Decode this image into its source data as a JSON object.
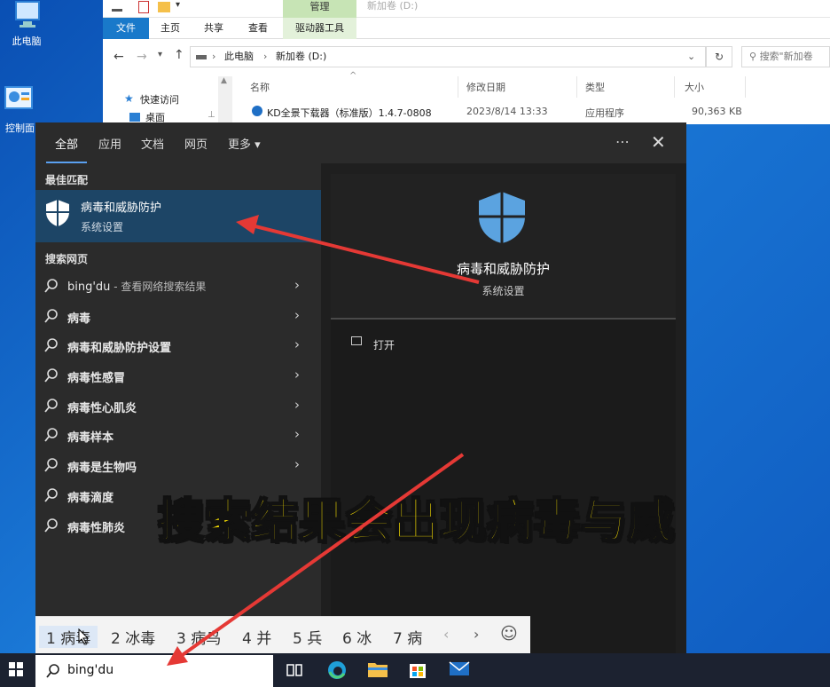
{
  "desktop": {
    "icons": [
      {
        "label": "此电脑",
        "icon": "computer-icon"
      },
      {
        "label": "控制面",
        "icon": "control-panel-icon"
      }
    ]
  },
  "explorer": {
    "manage_tab": "管理",
    "title": "新加卷 (D:)",
    "tabs": [
      "文件",
      "主页",
      "共享",
      "查看",
      "驱动器工具"
    ],
    "address_path": [
      "此电脑",
      "新加卷 (D:)"
    ],
    "search_placeholder": "搜索\"新加卷",
    "nav": {
      "quick_access": "快速访问",
      "desktop": "桌面"
    },
    "columns": [
      "名称",
      "修改日期",
      "类型",
      "大小"
    ],
    "rows": [
      {
        "name": "KD全景下载器（标准版）1.4.7-0808",
        "modified": "2023/8/14 13:33",
        "type": "应用程序",
        "size": "90,363 KB"
      }
    ]
  },
  "search_panel": {
    "tabs": [
      "全部",
      "应用",
      "文档",
      "网页",
      "更多 ▾"
    ],
    "more_icon": "ellipsis-icon",
    "close_icon": "close-icon",
    "best_match_heading": "最佳匹配",
    "best_match": {
      "title": "病毒和威胁防护",
      "subtitle": "系统设置",
      "icon": "shield-icon"
    },
    "web_heading": "搜索网页",
    "web_results": [
      {
        "text": "bing'du",
        "suffix": " - 查看网络搜索结果"
      },
      {
        "text": "病毒",
        "suffix": ""
      },
      {
        "text": "病毒和威胁防护设置",
        "suffix": ""
      },
      {
        "text": "病毒性感冒",
        "suffix": ""
      },
      {
        "text": "病毒性心肌炎",
        "suffix": ""
      },
      {
        "text": "病毒样本",
        "suffix": ""
      },
      {
        "text": "病毒是生物吗",
        "suffix": ""
      },
      {
        "text": "病毒滴度",
        "suffix": ""
      },
      {
        "text": "病毒性肺炎",
        "suffix": ""
      }
    ],
    "detail": {
      "title": "病毒和威胁防护",
      "subtitle": "系统设置",
      "open_label": "打开"
    }
  },
  "ime": {
    "candidates": [
      "1 病毒",
      "2 冰毒",
      "3 病鸟",
      "4 并",
      "5 兵",
      "6 冰",
      "7 病"
    ],
    "prev": "‹",
    "next": "›",
    "emoji": "☺"
  },
  "taskbar": {
    "search_query": "bing'du",
    "icons": [
      "windows-start-icon",
      "task-view-icon",
      "edge-icon",
      "file-explorer-icon",
      "store-icon",
      "mail-icon"
    ]
  },
  "caption": "搜索结果会出现病毒与威",
  "colors": {
    "accent": "#1979ca",
    "highlight": "#1d4566",
    "caption": "#ffe600",
    "arrow": "#e53935"
  }
}
